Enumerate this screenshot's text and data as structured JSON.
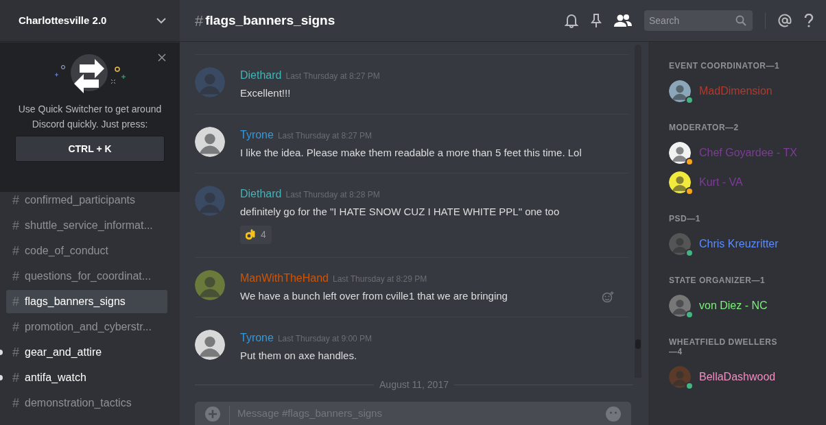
{
  "server": {
    "name": "Charlottesville 2.0"
  },
  "quick_switcher": {
    "text": "Use Quick Switcher to get around Discord quickly. Just press:",
    "shortcut": "CTRL + K"
  },
  "channels": [
    {
      "hash": "#",
      "name": "confirmed_participants",
      "selected": false,
      "unread": false
    },
    {
      "hash": "#",
      "name": "shuttle_service_informat...",
      "selected": false,
      "unread": false
    },
    {
      "hash": "#",
      "name": "code_of_conduct",
      "selected": false,
      "unread": false
    },
    {
      "hash": "#",
      "name": "questions_for_coordinat...",
      "selected": false,
      "unread": false
    },
    {
      "hash": "#",
      "name": "flags_banners_signs",
      "selected": true,
      "unread": false
    },
    {
      "hash": "#",
      "name": "promotion_and_cyberstr...",
      "selected": false,
      "unread": false
    },
    {
      "hash": "#",
      "name": "gear_and_attire",
      "selected": false,
      "unread": true
    },
    {
      "hash": "#",
      "name": "antifa_watch",
      "selected": false,
      "unread": true
    },
    {
      "hash": "#",
      "name": "demonstration_tactics",
      "selected": false,
      "unread": false
    }
  ],
  "channel_header": {
    "hash": "#",
    "name": "flags_banners_signs",
    "search": {
      "placeholder": "Search"
    },
    "members_shown": true
  },
  "messages": [
    {
      "author": "Diethard",
      "color": "#43b4b7",
      "time": "Last Thursday at 8:27 PM",
      "text": "Excellent!!!"
    },
    {
      "author": "Tyrone",
      "color": "#3498db",
      "time": "Last Thursday at 8:27 PM",
      "text": "I like the idea. Please make them readable a more than 5 feet this time. Lol"
    },
    {
      "author": "Diethard",
      "color": "#43b4b7",
      "time": "Last Thursday at 8:28 PM",
      "text": "definitely go for the \"I HATE SNOW CUZ I HATE WHITE PPL\" one too",
      "reaction": {
        "count": "4"
      }
    },
    {
      "author": "ManWithTheHand",
      "color": "#d35400",
      "time": "Last Thursday at 8:29 PM",
      "text": "We have a bunch left over from cville1 that we are bringing",
      "hovered": true
    },
    {
      "author": "Tyrone",
      "color": "#3498db",
      "time": "Last Thursday at 9:00 PM",
      "text": "Put them on axe handles."
    }
  ],
  "date_divider": "August 11, 2017",
  "message_input": {
    "placeholder": "Message #flags_banners_signs"
  },
  "member_groups": [
    {
      "title": "EVENT COORDINATOR—1",
      "members": [
        {
          "name": "MadDimension",
          "color": "#b03a2e",
          "idle": false
        }
      ]
    },
    {
      "title": "MODERATOR—2",
      "members": [
        {
          "name": "Chef Goyardee - TX",
          "color": "#7d3c98",
          "idle": true
        },
        {
          "name": "Kurt - VA",
          "color": "#7d3c98",
          "idle": true
        }
      ]
    },
    {
      "title": "PSD—1",
      "members": [
        {
          "name": "Chris Kreuzritter",
          "color": "#5a8cff",
          "idle": false
        }
      ]
    },
    {
      "title": "STATE ORGANIZER—1",
      "members": [
        {
          "name": "von Diez - NC",
          "color": "#7bf07b",
          "idle": false
        }
      ]
    },
    {
      "title": "WHEATFIELD DWELLERS—4",
      "members": [
        {
          "name": "BellaDashwood",
          "color": "#f08fc0",
          "idle": false
        }
      ]
    }
  ]
}
